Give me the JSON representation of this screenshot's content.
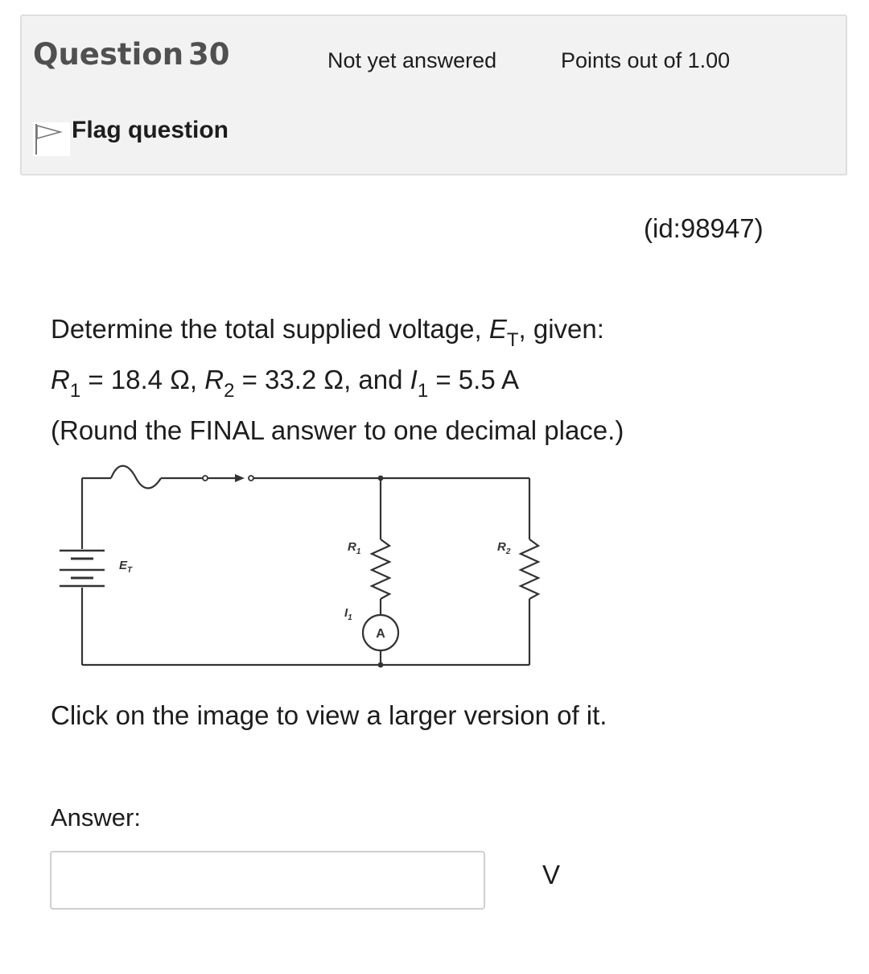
{
  "question": {
    "label": "Question",
    "number": "30",
    "state": "Not yet answered",
    "grade": "Points out of 1.00",
    "flag_label": "Flag question",
    "id_text": "(id:98947)"
  },
  "text": {
    "line1_prefix": "Determine the total supplied voltage, ",
    "line1_var": "E",
    "line1_sub": "T",
    "line1_suffix": ", given:",
    "r1_var": "R",
    "r1_sub": "1",
    "r1_val": " = 18.4 Ω, ",
    "r2_var": "R",
    "r2_sub": "2",
    "r2_val": " = 33.2 Ω, and ",
    "i1_var": "I",
    "i1_sub": "1",
    "i1_val": " = 5.5 A",
    "line3": "(Round the FINAL answer to one decimal place.)",
    "click_note": "Click on the image to view a larger version of it."
  },
  "circuit": {
    "source_label": "E",
    "source_sub": "T",
    "r1_label": "R",
    "r1_sub": "1",
    "r2_label": "R",
    "r2_sub": "2",
    "current_label": "I",
    "current_sub": "1",
    "meter_label": "A"
  },
  "answer": {
    "label": "Answer:",
    "value": "",
    "placeholder": "",
    "unit": "V"
  }
}
